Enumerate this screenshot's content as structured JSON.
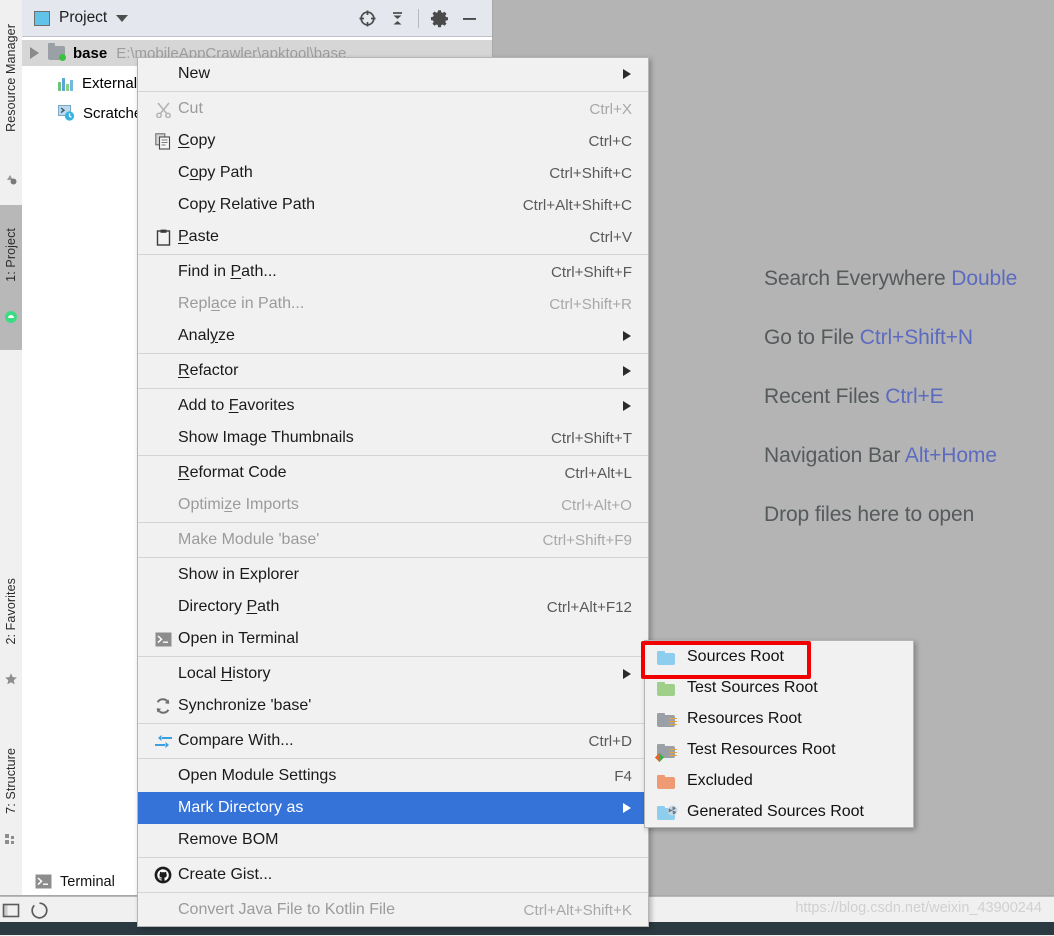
{
  "app": {
    "editor_background": "#b4b4b4",
    "menu_background": "#f1f1f1",
    "highlight_color": "#3573d9",
    "annotation_color": "#f20000"
  },
  "toolstrip": {
    "top_label": "Resource Manager",
    "project_label": "1: Project",
    "favorites_label": "2: Favorites",
    "structure_label": "7: Structure"
  },
  "project_window": {
    "title": "Project",
    "icons": [
      "locate-icon",
      "collapse-all-icon",
      "gear-icon",
      "minimize-icon"
    ],
    "tree": [
      {
        "name": "base",
        "path": "E:\\mobileAppCrawler\\apktool\\base",
        "icon": "module-folder-icon",
        "selected": true
      },
      {
        "name": "External Libraries",
        "path": "",
        "icon": "libraries-icon",
        "selected": false
      },
      {
        "name": "Scratches and Consoles",
        "path": "",
        "icon": "scratches-icon",
        "selected": false
      }
    ]
  },
  "editor_hints": [
    {
      "text": "Search Everywhere ",
      "shortcut": "Double"
    },
    {
      "text": "Go to File ",
      "shortcut": "Ctrl+Shift+N"
    },
    {
      "text": "Recent Files ",
      "shortcut": "Ctrl+E"
    },
    {
      "text": "Navigation Bar ",
      "shortcut": "Alt+Home"
    },
    {
      "text": "Drop files here to open",
      "shortcut": ""
    }
  ],
  "context_menu": {
    "items": [
      {
        "label": "New",
        "mnemonic": "",
        "accel": "",
        "arrow": true,
        "icon": "",
        "disabled": false,
        "sep_after": true
      },
      {
        "label": "Cut",
        "mnemonic": "t",
        "accel": "Ctrl+X",
        "arrow": false,
        "icon": "scissors-icon",
        "disabled": true,
        "sep_after": false
      },
      {
        "label": "Copy",
        "mnemonic": "C",
        "accel": "Ctrl+C",
        "arrow": false,
        "icon": "copy-icon",
        "disabled": false,
        "sep_after": false
      },
      {
        "label": "Copy Path",
        "mnemonic": "o",
        "accel": "Ctrl+Shift+C",
        "arrow": false,
        "icon": "",
        "disabled": false,
        "sep_after": false
      },
      {
        "label": "Copy Relative Path",
        "mnemonic": "y",
        "accel": "Ctrl+Alt+Shift+C",
        "arrow": false,
        "icon": "",
        "disabled": false,
        "sep_after": false
      },
      {
        "label": "Paste",
        "mnemonic": "P",
        "accel": "Ctrl+V",
        "arrow": false,
        "icon": "paste-icon",
        "disabled": false,
        "sep_after": true
      },
      {
        "label": "Find in Path...",
        "mnemonic": "P",
        "accel": "Ctrl+Shift+F",
        "arrow": false,
        "icon": "",
        "disabled": false,
        "sep_after": false
      },
      {
        "label": "Replace in Path...",
        "mnemonic": "a",
        "accel": "Ctrl+Shift+R",
        "arrow": false,
        "icon": "",
        "disabled": true,
        "sep_after": false
      },
      {
        "label": "Analyze",
        "mnemonic": "z",
        "accel": "",
        "arrow": true,
        "icon": "",
        "disabled": false,
        "sep_after": true
      },
      {
        "label": "Refactor",
        "mnemonic": "R",
        "accel": "",
        "arrow": true,
        "icon": "",
        "disabled": false,
        "sep_after": true
      },
      {
        "label": "Add to Favorites",
        "mnemonic": "F",
        "accel": "",
        "arrow": true,
        "icon": "",
        "disabled": false,
        "sep_after": false
      },
      {
        "label": "Show Image Thumbnails",
        "mnemonic": "",
        "accel": "Ctrl+Shift+T",
        "arrow": false,
        "icon": "",
        "disabled": false,
        "sep_after": true
      },
      {
        "label": "Reformat Code",
        "mnemonic": "R",
        "accel": "Ctrl+Alt+L",
        "arrow": false,
        "icon": "",
        "disabled": false,
        "sep_after": false
      },
      {
        "label": "Optimize Imports",
        "mnemonic": "z",
        "accel": "Ctrl+Alt+O",
        "arrow": false,
        "icon": "",
        "disabled": true,
        "sep_after": true
      },
      {
        "label": "Make Module 'base'",
        "mnemonic": "",
        "accel": "Ctrl+Shift+F9",
        "arrow": false,
        "icon": "",
        "disabled": true,
        "sep_after": true
      },
      {
        "label": "Show in Explorer",
        "mnemonic": "",
        "accel": "",
        "arrow": false,
        "icon": "",
        "disabled": false,
        "sep_after": false
      },
      {
        "label": "Directory Path",
        "mnemonic": "P",
        "accel": "Ctrl+Alt+F12",
        "arrow": false,
        "icon": "",
        "disabled": false,
        "sep_after": false
      },
      {
        "label": "Open in Terminal",
        "mnemonic": "",
        "accel": "",
        "arrow": false,
        "icon": "terminal-icon",
        "disabled": false,
        "sep_after": true
      },
      {
        "label": "Local History",
        "mnemonic": "H",
        "accel": "",
        "arrow": true,
        "icon": "",
        "disabled": false,
        "sep_after": false
      },
      {
        "label": "Synchronize 'base'",
        "mnemonic": "",
        "accel": "",
        "arrow": false,
        "icon": "refresh-icon",
        "disabled": false,
        "sep_after": true
      },
      {
        "label": "Compare With...",
        "mnemonic": "",
        "accel": "Ctrl+D",
        "arrow": false,
        "icon": "compare-icon",
        "disabled": false,
        "sep_after": true
      },
      {
        "label": "Open Module Settings",
        "mnemonic": "",
        "accel": "F4",
        "arrow": false,
        "icon": "",
        "disabled": false,
        "sep_after": false
      },
      {
        "label": "Mark Directory as",
        "mnemonic": "",
        "accel": "",
        "arrow": true,
        "icon": "",
        "disabled": false,
        "highlighted": true,
        "sep_after": false
      },
      {
        "label": "Remove BOM",
        "mnemonic": "",
        "accel": "",
        "arrow": false,
        "icon": "",
        "disabled": false,
        "sep_after": true
      },
      {
        "label": "Create Gist...",
        "mnemonic": "",
        "accel": "",
        "arrow": false,
        "icon": "github-icon",
        "disabled": false,
        "sep_after": true
      },
      {
        "label": "Convert Java File to Kotlin File",
        "mnemonic": "",
        "accel": "Ctrl+Alt+Shift+K",
        "arrow": false,
        "icon": "",
        "disabled": true,
        "sep_after": false
      }
    ]
  },
  "submenu": {
    "title": "Mark Directory as",
    "items": [
      {
        "label": "Sources Root",
        "icon": "folder-blue-icon",
        "color": "#8dcdee",
        "annotated": true
      },
      {
        "label": "Test Sources Root",
        "icon": "folder-green-icon",
        "color": "#9ed089",
        "annotated": false
      },
      {
        "label": "Resources Root",
        "icon": "folder-resources-icon",
        "color": "#9aa0a6",
        "annotated": false
      },
      {
        "label": "Test Resources Root",
        "icon": "folder-test-resources-icon",
        "color": "#9aa0a6",
        "annotated": false
      },
      {
        "label": "Excluded",
        "icon": "folder-orange-icon",
        "color": "#ee9a72",
        "annotated": false
      },
      {
        "label": "Generated Sources Root",
        "icon": "folder-generated-icon",
        "color": "#8dcdee",
        "annotated": false
      }
    ]
  },
  "status_bar": {
    "terminal_label": "Terminal",
    "watermark": "https://blog.csdn.net/weixin_43900244"
  }
}
